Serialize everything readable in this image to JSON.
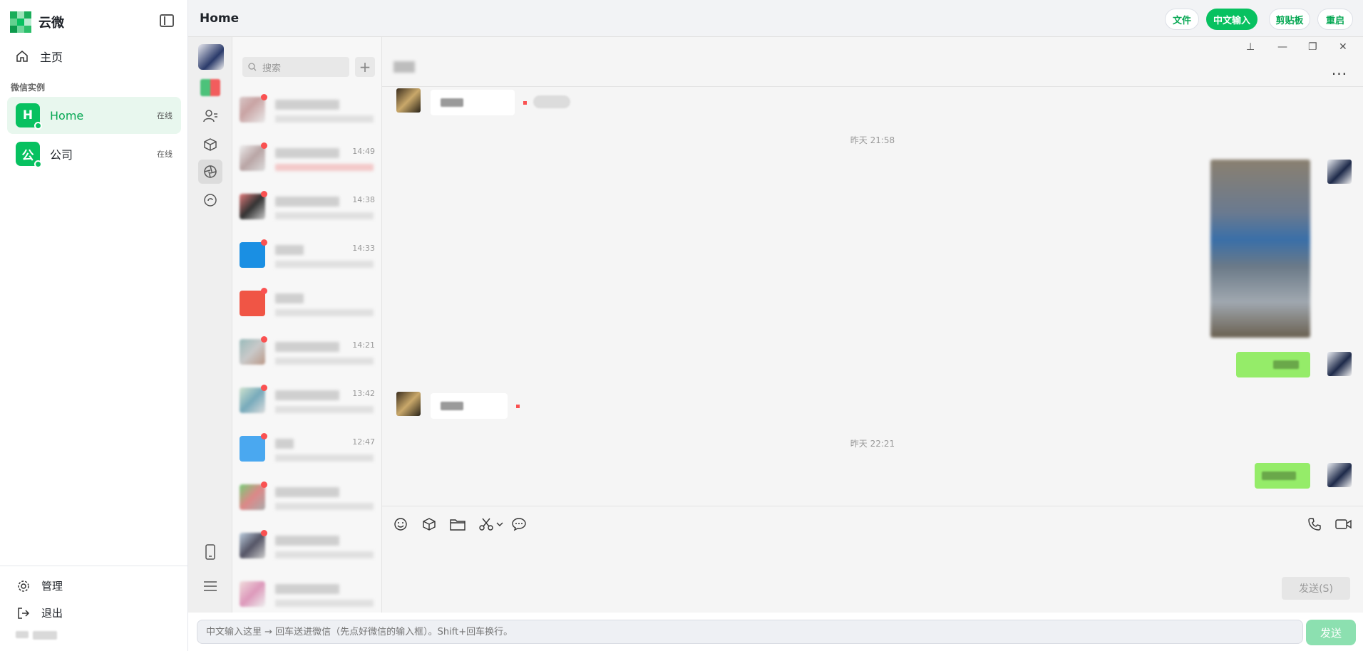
{
  "app": {
    "brand": "云微"
  },
  "sidebar": {
    "home_label": "主页",
    "section_title": "微信实例",
    "instances": [
      {
        "initial": "H",
        "name": "Home",
        "status": "在线"
      },
      {
        "initial": "公",
        "name": "公司",
        "status": "在线"
      }
    ],
    "manage_label": "管理",
    "logout_label": "退出"
  },
  "header": {
    "title": "Home",
    "buttons": {
      "files": "文件",
      "chinese_input": "中文输入",
      "clipboard": "剪贴板",
      "restart": "重启"
    }
  },
  "wechat": {
    "search_placeholder": "搜索",
    "add_symbol": "+",
    "conversation_times": [
      "",
      "14:49",
      "14:38",
      "14:33",
      "",
      "14:21",
      "13:42",
      "12:47",
      "",
      "",
      ""
    ],
    "chat": {
      "time_labels": [
        "昨天 21:58",
        "昨天 22:21"
      ],
      "send_label": "发送(S)",
      "more_symbol": "..."
    }
  },
  "input": {
    "placeholder": "中文输入这里 → 回车送进微信（先点好微信的输入框）。Shift+回车换行。",
    "send_label": "发送"
  },
  "colors": {
    "accent": "#07c160",
    "bubble_out": "#95ec69",
    "badge": "#fa5151"
  }
}
